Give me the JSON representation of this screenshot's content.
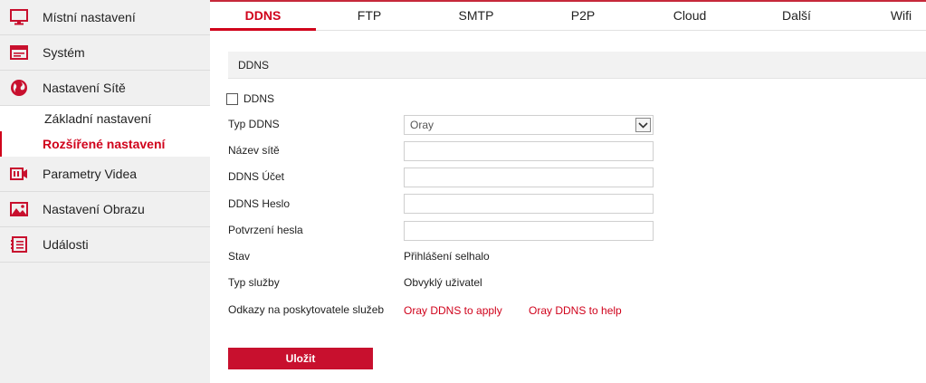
{
  "sidebar": {
    "items": [
      {
        "label": "Místní nastavení",
        "icon": "monitor-icon"
      },
      {
        "label": "Systém",
        "icon": "system-icon"
      },
      {
        "label": "Nastavení Sítě",
        "icon": "globe-icon"
      }
    ],
    "subitems": [
      {
        "label": "Základní nastavení"
      },
      {
        "label": "Rozšířené nastavení",
        "active": true
      }
    ],
    "items_after": [
      {
        "label": "Parametry Videa",
        "icon": "video-icon"
      },
      {
        "label": "Nastavení Obrazu",
        "icon": "image-icon"
      },
      {
        "label": "Události",
        "icon": "events-icon"
      }
    ]
  },
  "tabs": [
    {
      "label": "DDNS",
      "active": true
    },
    {
      "label": "FTP"
    },
    {
      "label": "SMTP"
    },
    {
      "label": "P2P"
    },
    {
      "label": "Cloud"
    },
    {
      "label": "Další"
    },
    {
      "label": "Wifi"
    }
  ],
  "section": {
    "title": "DDNS"
  },
  "form": {
    "enable_label": "DDNS",
    "enable_checked": false,
    "type_label": "Typ DDNS",
    "type_value": "Oray",
    "site_label": "Název sítě",
    "site_value": "",
    "account_label": "DDNS Účet",
    "account_value": "",
    "password_label": "DDNS Heslo",
    "password_value": "",
    "confirm_label": "Potvrzení hesla",
    "confirm_value": "",
    "status_label": "Stav",
    "status_value": "Přihlášení selhalo",
    "service_label": "Typ služby",
    "service_value": "Obvyklý uživatel",
    "links_label": "Odkazy na poskytovatele služeb",
    "link_apply": "Oray DDNS to apply",
    "link_help": "Oray DDNS to help",
    "save_label": "Uložit"
  },
  "colors": {
    "accent": "#d0021b",
    "sidebar_bg": "#f0f0f0",
    "button_bg": "#c8102e"
  }
}
